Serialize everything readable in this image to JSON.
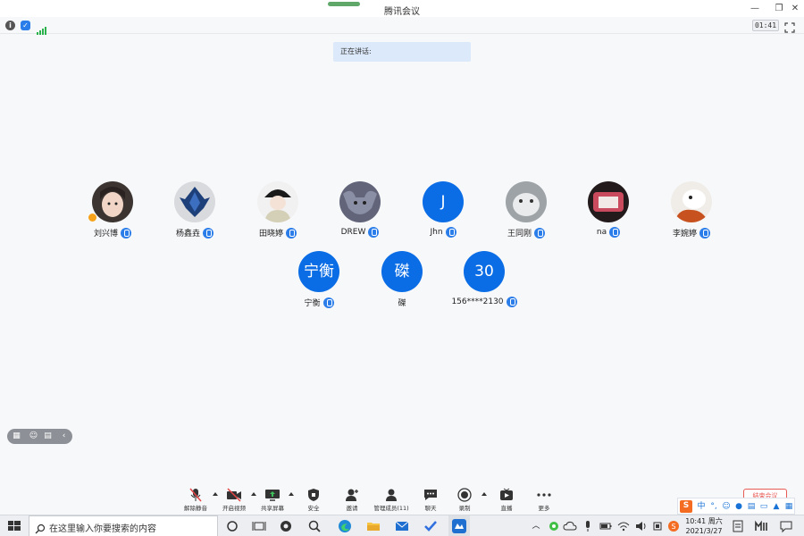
{
  "window": {
    "title": "腾讯会议"
  },
  "status": {
    "timer": "01:41"
  },
  "speaking_banner": "正在讲话:",
  "participants_row1": [
    {
      "name": "刘兴博",
      "avatar": "photo",
      "host": true
    },
    {
      "name": "杨鑫垚",
      "avatar": "photo"
    },
    {
      "name": "田晓婷",
      "avatar": "photo"
    },
    {
      "name": "DREW",
      "avatar": "photo"
    },
    {
      "name": "Jhn",
      "avatar": "letter",
      "letter": "J"
    },
    {
      "name": "王同刚",
      "avatar": "photo"
    },
    {
      "name": "na",
      "avatar": "photo"
    },
    {
      "name": "李婉婷",
      "avatar": "photo"
    }
  ],
  "participants_row2": [
    {
      "name": "宁衡",
      "avatar": "letter",
      "letter": "宁衡"
    },
    {
      "name": "磔",
      "avatar": "letter",
      "letter": "磔"
    },
    {
      "name": "156****2130",
      "avatar": "letter",
      "letter": "30"
    }
  ],
  "toolbar": {
    "unmute": "解除静音",
    "video": "开启视频",
    "share": "共享屏幕",
    "security": "安全",
    "invite": "邀请",
    "members": "管理成员(11)",
    "chat": "聊天",
    "record": "录制",
    "live": "直播",
    "more": "更多",
    "end": "结束会议"
  },
  "ime": {
    "lang": "中",
    "punct": "°,"
  },
  "taskbar": {
    "search_placeholder": "在这里输入你要搜索的内容",
    "time": "10:41 周六",
    "date": "2021/3/27"
  },
  "colors": {
    "accent": "#0b6de5",
    "mic": "#2b7de9",
    "end": "#e85a54"
  }
}
